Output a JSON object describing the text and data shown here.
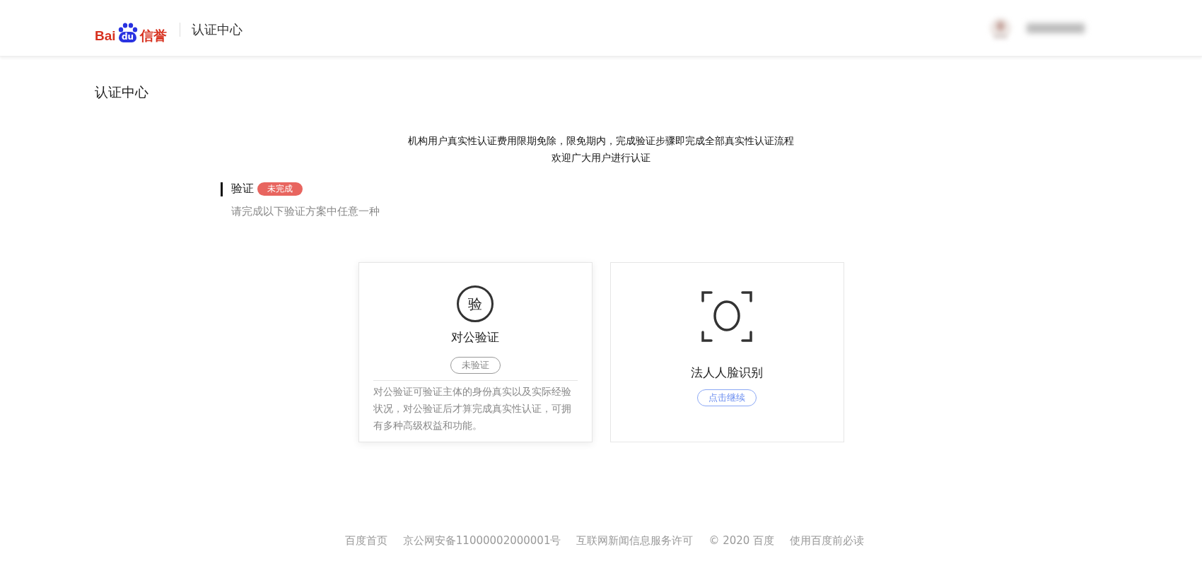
{
  "header": {
    "logo": {
      "left": "Bai",
      "mark": "du",
      "right": "信誉"
    },
    "title": "认证中心"
  },
  "page_title": "认证中心",
  "notice": [
    "机构用户真实性认证费用限期免除，限免期内，完成验证步骤即完成全部真实性认证流程",
    "欢迎广大用户进行认证"
  ],
  "section": {
    "title": "验证",
    "status": "未完成",
    "subtitle": "请完成以下验证方案中任意一种"
  },
  "options": [
    {
      "kind": "seal",
      "glyph": "验",
      "title": "对公验证",
      "action": "未验证",
      "completed": false,
      "clickable": false,
      "description": "对公验证可验证主体的身份真实以及实际经验状况，对公验证后才算完成真实性认证，可拥有多种高级权益和功能。"
    },
    {
      "kind": "face",
      "title": "法人人脸识别",
      "action": "点击继续",
      "completed": false,
      "clickable": true
    }
  ],
  "footer": [
    "百度首页",
    "京公网安备11000002000001号",
    "互联网新闻信息服务许可",
    "© 2020 百度",
    "使用百度前必读"
  ]
}
